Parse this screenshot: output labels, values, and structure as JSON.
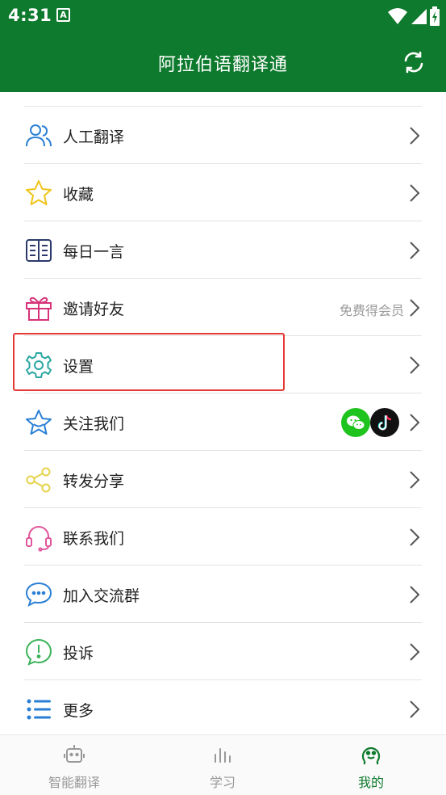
{
  "status_bar": {
    "time": "4:31",
    "notification_icon": "A"
  },
  "app_bar": {
    "title": "阿拉伯语翻译通",
    "refresh_icon": "refresh-icon"
  },
  "menu": {
    "items": [
      {
        "label": "人工翻译",
        "icon": "person-icon"
      },
      {
        "label": "收藏",
        "icon": "star-icon"
      },
      {
        "label": "每日一言",
        "icon": "book-icon"
      },
      {
        "label": "邀请好友",
        "icon": "gift-icon",
        "right_text": "免费得会员"
      },
      {
        "label": "设置",
        "icon": "gear-icon"
      },
      {
        "label": "关注我们",
        "icon": "star-badge-icon",
        "badges": [
          "wechat-icon",
          "tiktok-icon"
        ]
      },
      {
        "label": "转发分享",
        "icon": "share-icon"
      },
      {
        "label": "联系我们",
        "icon": "headset-icon"
      },
      {
        "label": "加入交流群",
        "icon": "chat-icon"
      },
      {
        "label": "投诉",
        "icon": "alert-icon"
      },
      {
        "label": "更多",
        "icon": "list-icon"
      }
    ]
  },
  "bottom_nav": {
    "items": [
      {
        "label": "智能翻译",
        "icon": "robot-icon",
        "active": false
      },
      {
        "label": "学习",
        "icon": "chart-icon",
        "active": false
      },
      {
        "label": "我的",
        "icon": "profile-icon",
        "active": true
      }
    ]
  },
  "colors": {
    "brand": "#0e7a2d",
    "highlight": "#e53935",
    "divider": "#e3e3e3",
    "muted_text": "#9a9a9a"
  }
}
